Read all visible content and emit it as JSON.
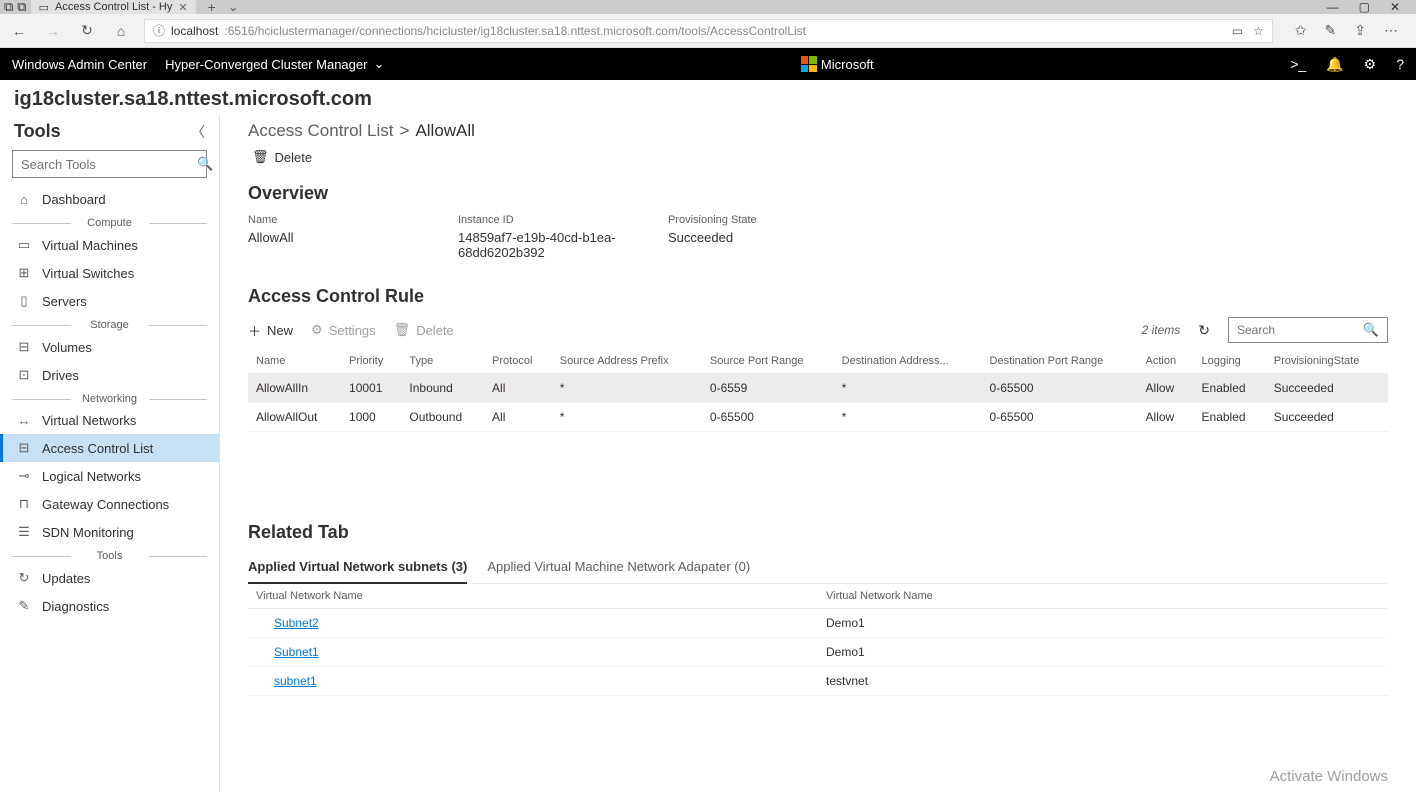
{
  "browser": {
    "tab_title": "Access Control List - Hy",
    "url_host": "localhost",
    "url_path": ":6516/hciclustermanager/connections/hcicluster/ig18cluster.sa18.nttest.microsoft.com/tools/AccessControlList"
  },
  "header": {
    "brand": "Windows Admin Center",
    "manager": "Hyper-Converged Cluster Manager",
    "ms_label": "Microsoft"
  },
  "cluster_name": "ig18cluster.sa18.nttest.microsoft.com",
  "sidebar": {
    "title": "Tools",
    "search_placeholder": "Search Tools",
    "groups": {
      "compute": "Compute",
      "storage": "Storage",
      "networking": "Networking",
      "tools": "Tools"
    },
    "items": {
      "dashboard": "Dashboard",
      "virtual_machines": "Virtual Machines",
      "virtual_switches": "Virtual Switches",
      "servers": "Servers",
      "volumes": "Volumes",
      "drives": "Drives",
      "virtual_networks": "Virtual Networks",
      "access_control_list": "Access Control List",
      "logical_networks": "Logical Networks",
      "gateway_connections": "Gateway Connections",
      "sdn_monitoring": "SDN Monitoring",
      "updates": "Updates",
      "diagnostics": "Diagnostics"
    }
  },
  "breadcrumb": {
    "root": "Access Control List",
    "leaf": "AllowAll"
  },
  "actions": {
    "delete": "Delete"
  },
  "overview": {
    "heading": "Overview",
    "name_label": "Name",
    "name_value": "AllowAll",
    "instance_label": "Instance ID",
    "instance_value": "14859af7-e19b-40cd-b1ea-68dd6202b392",
    "prov_label": "Provisioning State",
    "prov_value": "Succeeded"
  },
  "rules": {
    "heading": "Access Control Rule",
    "toolbar": {
      "new": "New",
      "settings": "Settings",
      "delete": "Delete",
      "count": "2 items",
      "search_placeholder": "Search"
    },
    "columns": {
      "name": "Name",
      "priority": "Priority",
      "type": "Type",
      "protocol": "Protocol",
      "src_prefix": "Source Address Prefix",
      "src_port": "Source Port Range",
      "dst_prefix": "Destination Address...",
      "dst_port": "Destination Port Range",
      "action": "Action",
      "logging": "Logging",
      "prov": "ProvisioningState"
    },
    "rows": [
      {
        "name": "AllowAllIn",
        "priority": "10001",
        "type": "Inbound",
        "protocol": "All",
        "src_prefix": "*",
        "src_port": "0-6559",
        "dst_prefix": "*",
        "dst_port": "0-65500",
        "action": "Allow",
        "logging": "Enabled",
        "prov": "Succeeded",
        "selected": true
      },
      {
        "name": "AllowAllOut",
        "priority": "1000",
        "type": "Outbound",
        "protocol": "All",
        "src_prefix": "*",
        "src_port": "0-65500",
        "dst_prefix": "*",
        "dst_port": "0-65500",
        "action": "Allow",
        "logging": "Enabled",
        "prov": "Succeeded",
        "selected": false
      }
    ]
  },
  "related": {
    "heading": "Related Tab",
    "tab_subnets": "Applied Virtual Network subnets (3)",
    "tab_adapters": "Applied Virtual Machine Network Adapater (0)",
    "columns": {
      "subnet": "Virtual Network Name",
      "vnet": "Virtual Network Name"
    },
    "rows": [
      {
        "subnet": "Subnet2",
        "vnet": "Demo1"
      },
      {
        "subnet": "Subnet1",
        "vnet": "Demo1"
      },
      {
        "subnet": "subnet1",
        "vnet": "testvnet"
      }
    ]
  },
  "watermark": "Activate Windows"
}
